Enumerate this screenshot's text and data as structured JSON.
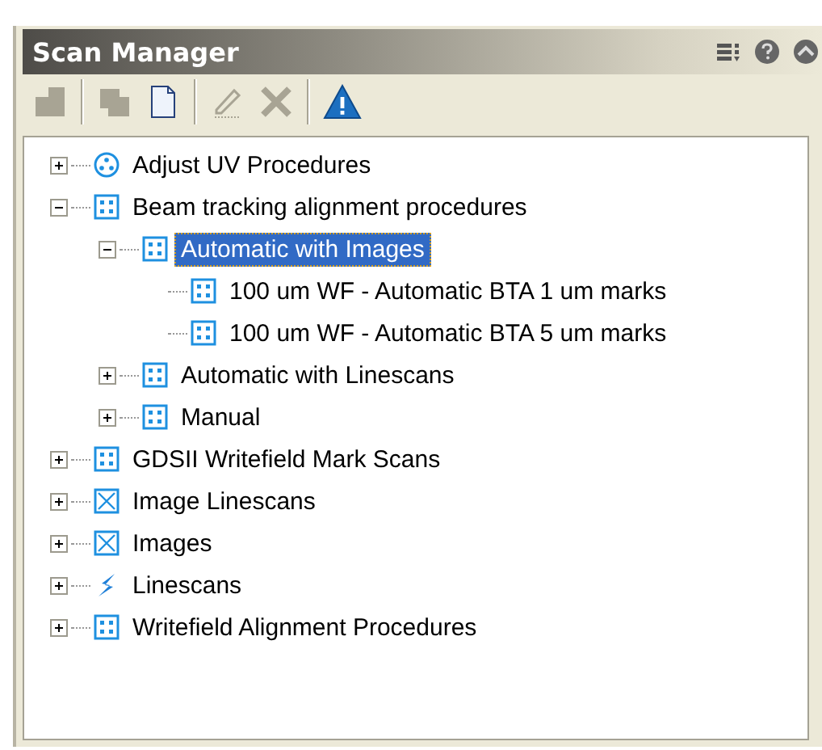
{
  "panel": {
    "title": "Scan Manager"
  },
  "toolbar": [
    {
      "kind": "move",
      "disabled": true
    },
    {
      "kind": "sep"
    },
    {
      "kind": "copy",
      "disabled": true
    },
    {
      "kind": "new",
      "disabled": false
    },
    {
      "kind": "sep"
    },
    {
      "kind": "edit",
      "disabled": true
    },
    {
      "kind": "delete",
      "disabled": true
    },
    {
      "kind": "sep"
    },
    {
      "kind": "warning",
      "disabled": false
    }
  ],
  "tree": [
    {
      "label": "Adjust UV Procedures",
      "kind": "dots",
      "expanded": false,
      "selected": false
    },
    {
      "label": "Beam tracking alignment procedures",
      "kind": "grid",
      "expanded": true,
      "selected": false,
      "children": [
        {
          "label": "Automatic with Images",
          "kind": "grid",
          "expanded": true,
          "selected": true,
          "children": [
            {
              "label": "100 um WF - Automatic BTA 1 um marks",
              "kind": "grid",
              "selected": false
            },
            {
              "label": "100 um WF - Automatic BTA 5 um marks",
              "kind": "grid",
              "selected": false
            }
          ]
        },
        {
          "label": "Automatic with Linescans",
          "kind": "grid",
          "expanded": false,
          "selected": false
        },
        {
          "label": "Manual",
          "kind": "grid",
          "expanded": false,
          "selected": false
        }
      ]
    },
    {
      "label": "GDSII Writefield Mark Scans",
      "kind": "grid",
      "expanded": false,
      "selected": false
    },
    {
      "label": "Image Linescans",
      "kind": "cross",
      "expanded": false,
      "selected": false
    },
    {
      "label": "Images",
      "kind": "cross",
      "expanded": false,
      "selected": false
    },
    {
      "label": "Linescans",
      "kind": "bolt",
      "expanded": false,
      "selected": false
    },
    {
      "label": "Writefield Alignment Procedures",
      "kind": "grid",
      "expanded": false,
      "selected": false
    }
  ]
}
